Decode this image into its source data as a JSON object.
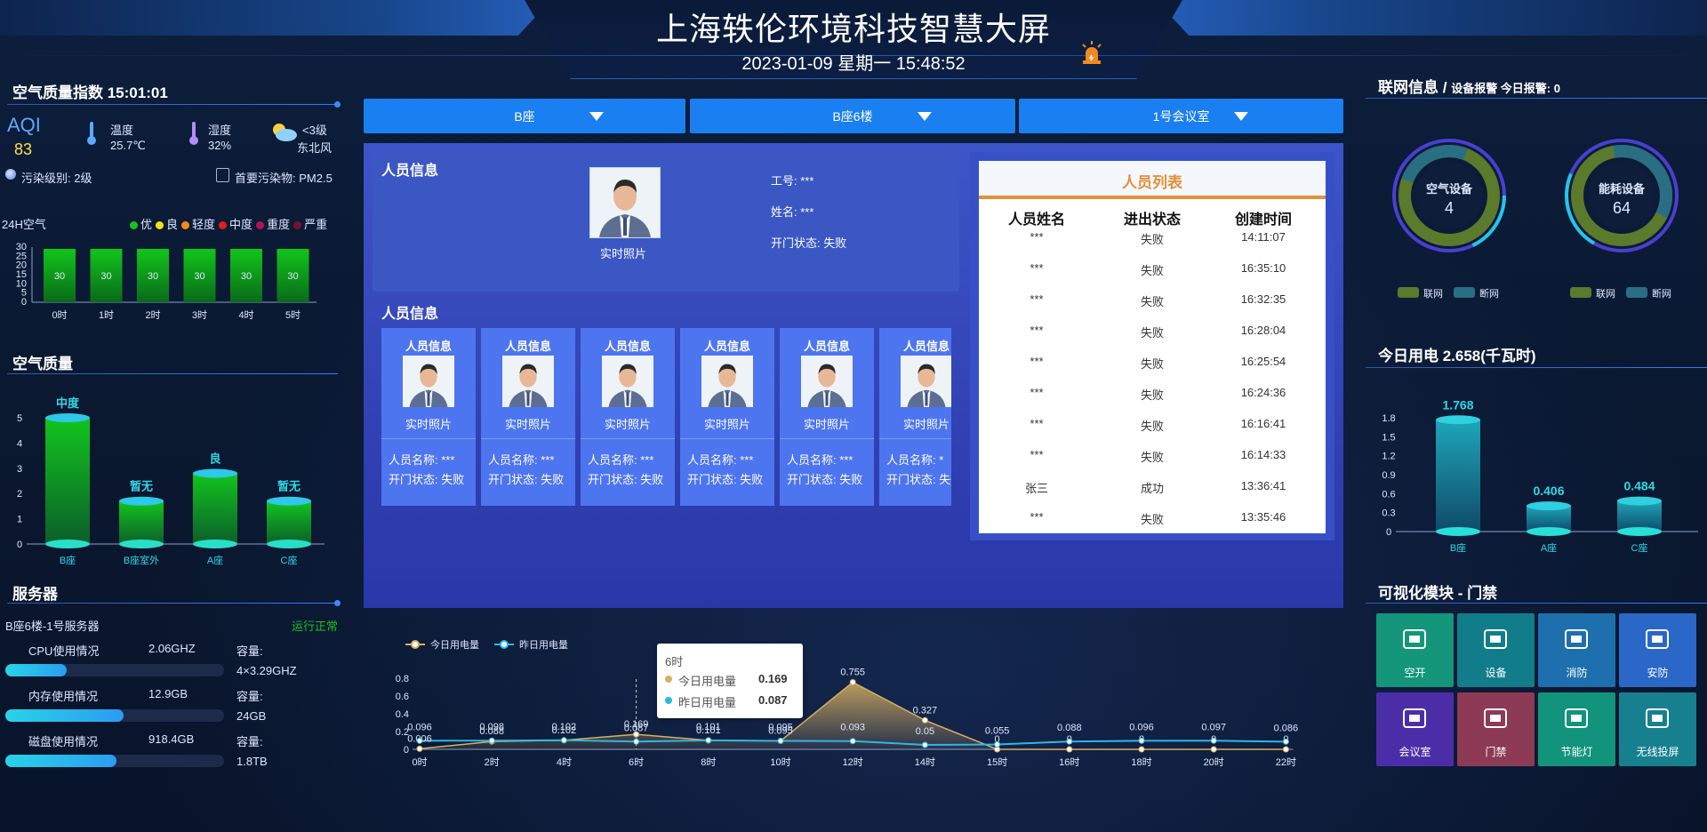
{
  "header": {
    "title": "上海轶伦环境科技智慧大屏",
    "datetime": "2023-01-09 星期一 15:48:52"
  },
  "left": {
    "aqi_title": "空气质量指数 15:01:01",
    "aqi_label": "AQI",
    "aqi_value": "83",
    "temp_label": "温度",
    "temp_value": "25.7℃",
    "humid_label": "湿度",
    "humid_value": "32%",
    "wind_level": "<3级",
    "wind_dir": "东北风",
    "pollution_level": "污染级别: 2级",
    "main_pollutant": "首要污染物: PM2.5",
    "air24_label": "24H空气",
    "legend": [
      {
        "label": "优",
        "color": "#19c21d"
      },
      {
        "label": "良",
        "color": "#f5e21a"
      },
      {
        "label": "轻度",
        "color": "#f58a1a"
      },
      {
        "label": "中度",
        "color": "#e81a1a"
      },
      {
        "label": "重度",
        "color": "#b0135a"
      },
      {
        "label": "严重",
        "color": "#7a1030"
      }
    ],
    "air_quality_title": "空气质量",
    "server_title": "服务器",
    "server_name": "B座6楼-1号服务器",
    "server_status": "运行正常",
    "server_rows": [
      {
        "label": "CPU使用情况",
        "value": "2.06GHZ",
        "cap_label": "容量:",
        "cap_value": "4×3.29GHZ",
        "pct": 0.28
      },
      {
        "label": "内存使用情况",
        "value": "12.9GB",
        "cap_label": "容量:",
        "cap_value": "24GB",
        "pct": 0.54
      },
      {
        "label": "磁盘使用情况",
        "value": "918.4GB",
        "cap_label": "容量:",
        "cap_value": "1.8TB",
        "pct": 0.51
      }
    ]
  },
  "chart_data": [
    {
      "type": "bar",
      "title": "24H空气",
      "categories": [
        "0时",
        "1时",
        "2时",
        "3时",
        "4时",
        "5时"
      ],
      "values": [
        30,
        30,
        30,
        30,
        30,
        30
      ],
      "yticks": [
        "30",
        "25",
        "20",
        "15",
        "10",
        "5",
        "0"
      ],
      "ylim": [
        0,
        30
      ]
    },
    {
      "type": "bar",
      "title": "空气质量",
      "categories": [
        "B座",
        "B座室外",
        "A座",
        "C座"
      ],
      "values": [
        5,
        1.7,
        2.8,
        1.7
      ],
      "labels": [
        "中度",
        "暂无",
        "良",
        "暂无"
      ],
      "yticks": [
        "5",
        "4",
        "3",
        "2",
        "1",
        "0"
      ],
      "ylim": [
        0,
        5
      ]
    },
    {
      "type": "bar",
      "title": "今日用电 2.658(千瓦时)",
      "categories": [
        "B座",
        "A座",
        "C座"
      ],
      "values": [
        1.768,
        0.406,
        0.484
      ],
      "yticks": [
        "1.8",
        "1.5",
        "1.2",
        "0.9",
        "0.6",
        "0.3",
        "0"
      ],
      "ylim": [
        0,
        1.8
      ]
    },
    {
      "type": "area",
      "x": [
        "0时",
        "2时",
        "4时",
        "6时",
        "8时",
        "10时",
        "12时",
        "14时",
        "15时",
        "16时",
        "18时",
        "20时",
        "22时"
      ],
      "series": [
        {
          "name": "今日用电量",
          "color": "#d8b060",
          "values": [
            0.006,
            0.088,
            0.102,
            0.169,
            0.101,
            0.095,
            0.755,
            0.327,
            0,
            0,
            0,
            0,
            0
          ]
        },
        {
          "name": "昨日用电量",
          "color": "#2fb6e6",
          "values": [
            0.096,
            0.098,
            0.102,
            0.087,
            0.101,
            0.095,
            0.093,
            0.05,
            0.055,
            0.088,
            0.096,
            0.097,
            0.086
          ]
        }
      ],
      "yticks": [
        "0.8",
        "0.6",
        "0.4",
        "0.2",
        "0"
      ],
      "ylim": [
        0,
        0.8
      ],
      "tooltip": {
        "title": "6时",
        "today_label": "今日用电量",
        "today_value": "0.169",
        "yest_label": "昨日用电量",
        "yest_value": "0.087"
      }
    }
  ],
  "center": {
    "select1": "B座",
    "select2": "B座6楼",
    "select3": "1号会议室",
    "person_info_title": "人员信息",
    "photo_caption": "实时照片",
    "job_id": "工号: ***",
    "name": "姓名: ***",
    "door_status": "开门状态: 失败",
    "cards_title": "人员信息",
    "cards": [
      {
        "title": "人员信息",
        "caption": "实时照片",
        "name": "人员名称: ***",
        "status": "开门状态: 失败"
      },
      {
        "title": "人员信息",
        "caption": "实时照片",
        "name": "人员名称: ***",
        "status": "开门状态: 失败"
      },
      {
        "title": "人员信息",
        "caption": "实时照片",
        "name": "人员名称: ***",
        "status": "开门状态: 失败"
      },
      {
        "title": "人员信息",
        "caption": "实时照片",
        "name": "人员名称: ***",
        "status": "开门状态: 失败"
      },
      {
        "title": "人员信息",
        "caption": "实时照片",
        "name": "人员名称: ***",
        "status": "开门状态: 失败"
      },
      {
        "title": "人员信息",
        "caption": "实时照片",
        "name": "人员名称: *",
        "status": "开门状态: 失"
      }
    ],
    "list_title": "人员列表",
    "list_headers": [
      "人员姓名",
      "进出状态",
      "创建时间"
    ],
    "list_rows": [
      [
        "***",
        "失败",
        "14:11:07"
      ],
      [
        "***",
        "失败",
        "16:35:10"
      ],
      [
        "***",
        "失败",
        "16:32:35"
      ],
      [
        "***",
        "失败",
        "16:28:04"
      ],
      [
        "***",
        "失败",
        "16:25:54"
      ],
      [
        "***",
        "失败",
        "16:24:36"
      ],
      [
        "***",
        "失败",
        "16:16:41"
      ],
      [
        "***",
        "失败",
        "16:14:33"
      ],
      [
        "张三",
        "成功",
        "13:36:41"
      ],
      [
        "***",
        "失败",
        "13:35:46"
      ]
    ]
  },
  "right": {
    "net_title": "联网信息 /",
    "net_sub": "设备报警  今日报警: 0",
    "donut1_label": "空气设备",
    "donut1_value": "4",
    "donut2_label": "能耗设备",
    "donut2_value": "64",
    "legend_online": "联网",
    "legend_offline": "断网",
    "power_title": "今日用电 2.658(千瓦时)",
    "module_title": "可视化模块 - 门禁",
    "tiles": [
      {
        "label": "空开",
        "color": "#13967a",
        "icon": "breaker-icon"
      },
      {
        "label": "设备",
        "color": "#117d8a",
        "icon": "device-icon"
      },
      {
        "label": "消防",
        "color": "#1e6fae",
        "icon": "fire-icon"
      },
      {
        "label": "安防",
        "color": "#2b67c7",
        "icon": "camera-icon"
      },
      {
        "label": "会议室",
        "color": "#4b2ea7",
        "icon": "meeting-icon"
      },
      {
        "label": "门禁",
        "color": "#8d3a56",
        "icon": "door-icon"
      },
      {
        "label": "节能灯",
        "color": "#11937c",
        "icon": "lamp-icon"
      },
      {
        "label": "无线投屏",
        "color": "#17808f",
        "icon": "wifi-icon"
      }
    ]
  }
}
